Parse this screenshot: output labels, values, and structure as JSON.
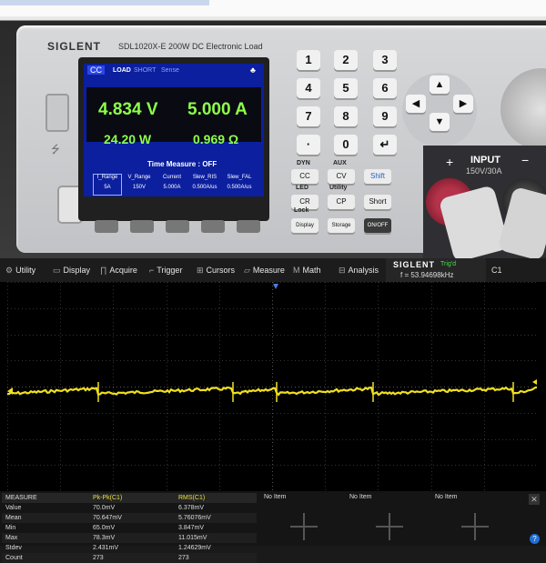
{
  "device": {
    "brand": "SIGLENT",
    "model": "SDL1020X-E 200W DC Electronic Load",
    "screen": {
      "mode": "CC",
      "tabs": [
        "LOAD",
        "SHORT",
        "Sense"
      ],
      "voltage": "4.834 V",
      "current": "5.000 A",
      "power": "24.20 W",
      "resistance": "0.969 Ω",
      "time_measure": "Time Measure  :  OFF",
      "params": [
        {
          "label": "I_Range",
          "value": "5A"
        },
        {
          "label": "V_Range",
          "value": "150V"
        },
        {
          "label": "Current",
          "value": "5.000A"
        },
        {
          "label": "Slew_RIS",
          "value": "0.500A/us"
        },
        {
          "label": "Slew_FAL",
          "value": "0.500A/us"
        }
      ]
    },
    "keypad": [
      "1",
      "2",
      "3",
      "4",
      "5",
      "6",
      "7",
      "8",
      "9",
      "·",
      "0",
      "↵"
    ],
    "func_labels": {
      "dyn": "DYN",
      "aux": "AUX",
      "led": "LED",
      "utility": "Utility",
      "lock": "Lock"
    },
    "func_keys": [
      "CC",
      "CV",
      "Shift",
      "CR",
      "CP",
      "Short",
      "Display",
      "Storage",
      "ON/OFF"
    ],
    "input_label": "INPUT",
    "rating": "150V/30A",
    "plus": "+",
    "minus": "−"
  },
  "scope": {
    "menu": [
      {
        "icon": "⚙",
        "label": "Utility"
      },
      {
        "icon": "▭",
        "label": "Display"
      },
      {
        "icon": "∏",
        "label": "Acquire"
      },
      {
        "icon": "⌐",
        "label": "Trigger"
      },
      {
        "icon": "⊞",
        "label": "Cursors"
      },
      {
        "icon": "▱",
        "label": "Measure"
      },
      {
        "icon": "M",
        "label": "Math"
      },
      {
        "icon": "⊟",
        "label": "Analysis"
      }
    ],
    "brand": "SIGLENT",
    "trig_status": "Trig'd",
    "frequency": "f = 53.94698kHz",
    "channel": "C1",
    "trace_color": "#f0e020",
    "measure": {
      "header": [
        "MEASURE",
        "Pk-Pk(C1)",
        "RMS(C1)"
      ],
      "rows": [
        [
          "Value",
          "70.0mV",
          "6.378mV"
        ],
        [
          "Mean",
          "70.647mV",
          "5.76076mV"
        ],
        [
          "Min",
          "65.0mV",
          "3.847mV"
        ],
        [
          "Max",
          "78.3mV",
          "11.015mV"
        ],
        [
          "Stdev",
          "2.431mV",
          "1.24629mV"
        ],
        [
          "Count",
          "273",
          "273"
        ]
      ],
      "empty_slots": [
        "No Item",
        "No Item",
        "No Item"
      ]
    }
  }
}
